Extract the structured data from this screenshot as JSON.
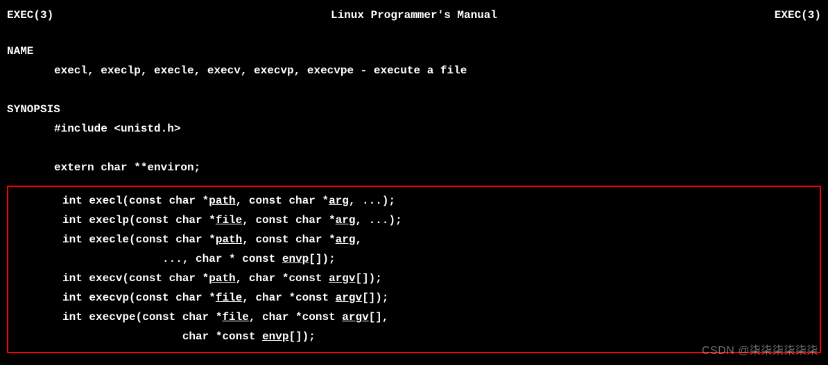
{
  "header": {
    "left": "EXEC(3)",
    "center": "Linux Programmer's Manual",
    "right": "EXEC(3)"
  },
  "name": {
    "title": "NAME",
    "line": "execl, execlp, execle, execv, execvp, execvpe - execute a file"
  },
  "synopsis": {
    "title": "SYNOPSIS",
    "include": "#include <unistd.h>",
    "externl": "extern char **environ;",
    "fn": {
      "execl_a": "int execl(const char *",
      "execl_p": "path",
      "execl_b": ", const char *",
      "execl_q": "arg",
      "execl_c": ", ...);",
      "execlp_a": "int execlp(const char *",
      "execlp_p": "file",
      "execlp_b": ", const char *",
      "execlp_q": "arg",
      "execlp_c": ", ...);",
      "execle_a": "int execle(const char *",
      "execle_p": "path",
      "execle_b": ", const char *",
      "execle_q": "arg",
      "execle_c": ",",
      "execle_d": "..., char * const ",
      "execle_r": "envp",
      "execle_e": "[]);",
      "execle_indent": "               ",
      "execv_a": "int execv(const char *",
      "execv_p": "path",
      "execv_b": ", char *const ",
      "execv_q": "argv",
      "execv_c": "[]);",
      "execvp_a": "int execvp(const char *",
      "execvp_p": "file",
      "execvp_b": ", char *const ",
      "execvp_q": "argv",
      "execvp_c": "[]);",
      "execvpe_a": "int execvpe(const char *",
      "execvpe_p": "file",
      "execvpe_b": ", char *const ",
      "execvpe_q": "argv",
      "execvpe_c": "[],",
      "execvpe_d": "char *const ",
      "execvpe_r": "envp",
      "execvpe_e": "[]);",
      "execvpe_indent": "                  "
    }
  },
  "watermark": "CSDN @柒柒柒柒柒柒"
}
